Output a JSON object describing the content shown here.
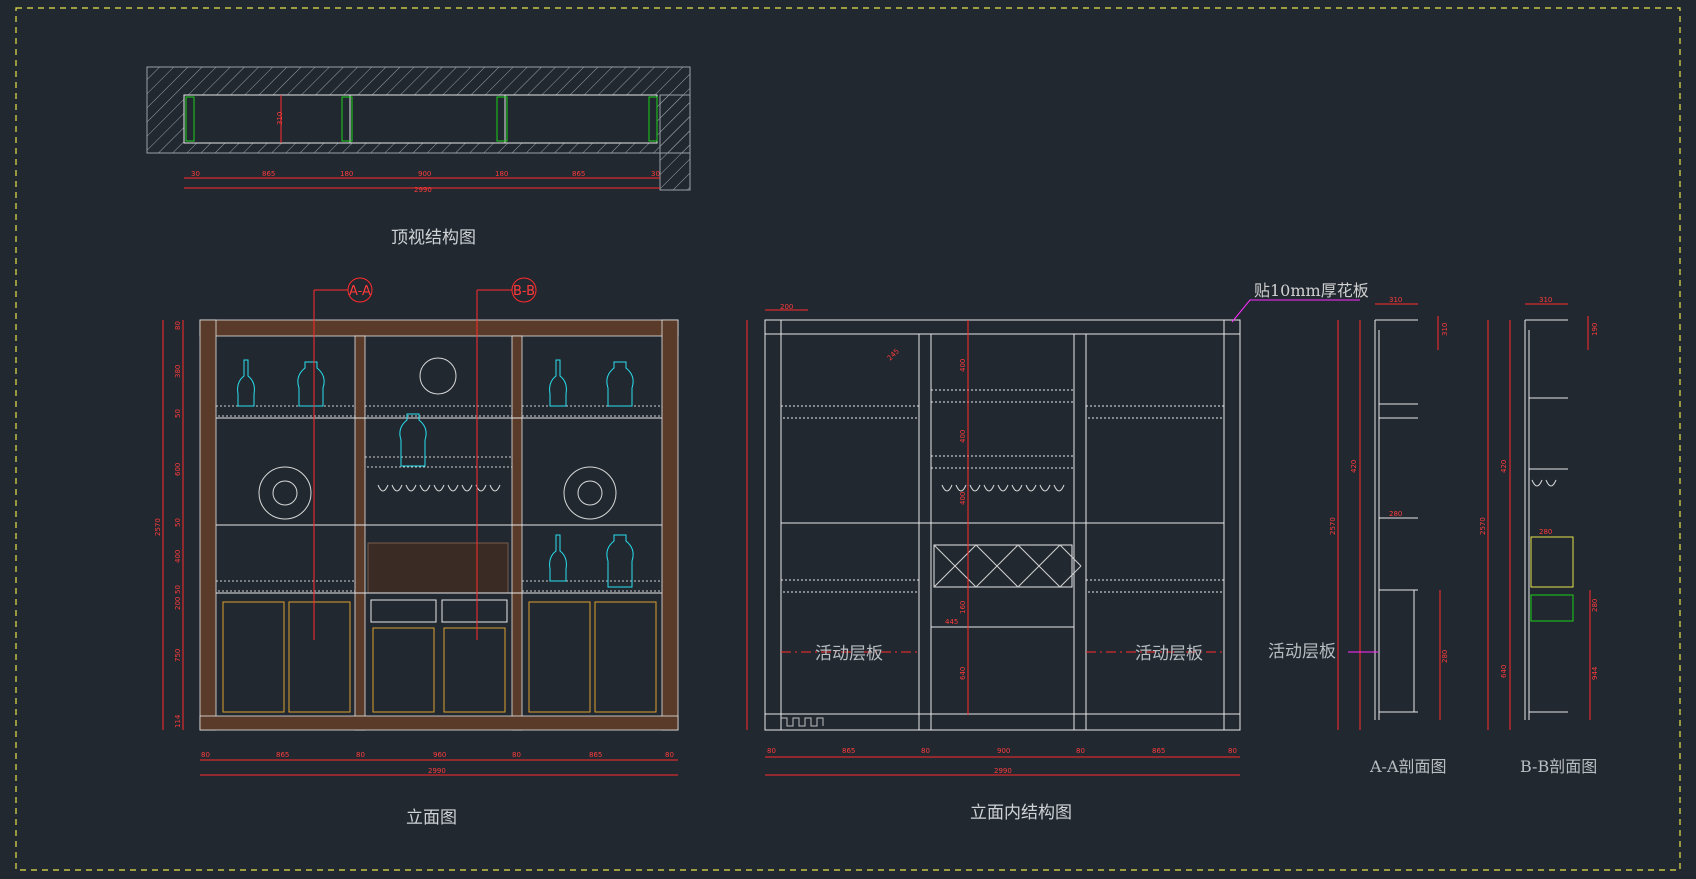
{
  "colors": {
    "background": "#212830",
    "border": "#e7e34a",
    "dimension": "#ff2b2b",
    "line": "#e8e8e8",
    "wood": "#5a3a28",
    "accent_cyan": "#29e0ef",
    "accent_green": "#1ad01a",
    "leader_magenta": "#ff2dff"
  },
  "titles": {
    "top_view": "顶视结构图",
    "front": "立面图",
    "inner": "立面内结构图",
    "section_a": "A-A剖面图",
    "section_b": "B-B剖面图"
  },
  "labels": {
    "panel_note": "贴10mm厚花板",
    "shelf_left": "活动层板",
    "shelf_right": "活动层板",
    "shelf_section": "活动层板",
    "marker_a": "A-A",
    "marker_b": "B-B"
  },
  "dims": {
    "top_view": [
      "30",
      "865",
      "180",
      "900",
      "180",
      "865",
      "30",
      "2990",
      "310"
    ],
    "front_bottom": [
      "80",
      "865",
      "80",
      "960",
      "80",
      "865",
      "80",
      "2990"
    ],
    "front_left": [
      "80",
      "380",
      "50",
      "600",
      "50",
      "400",
      "50",
      "200",
      "750",
      "114",
      "2570"
    ],
    "inner_bottom": [
      "80",
      "865",
      "80",
      "900",
      "80",
      "865",
      "80",
      "2990"
    ],
    "inner_mid": [
      "400",
      "400",
      "400",
      "445",
      "160",
      "640",
      "245",
      "200"
    ],
    "section_a": [
      "310",
      "280",
      "420",
      "2570",
      "310",
      "280"
    ],
    "section_b": [
      "310",
      "280",
      "420",
      "2570",
      "190",
      "280",
      "640",
      "944"
    ]
  }
}
